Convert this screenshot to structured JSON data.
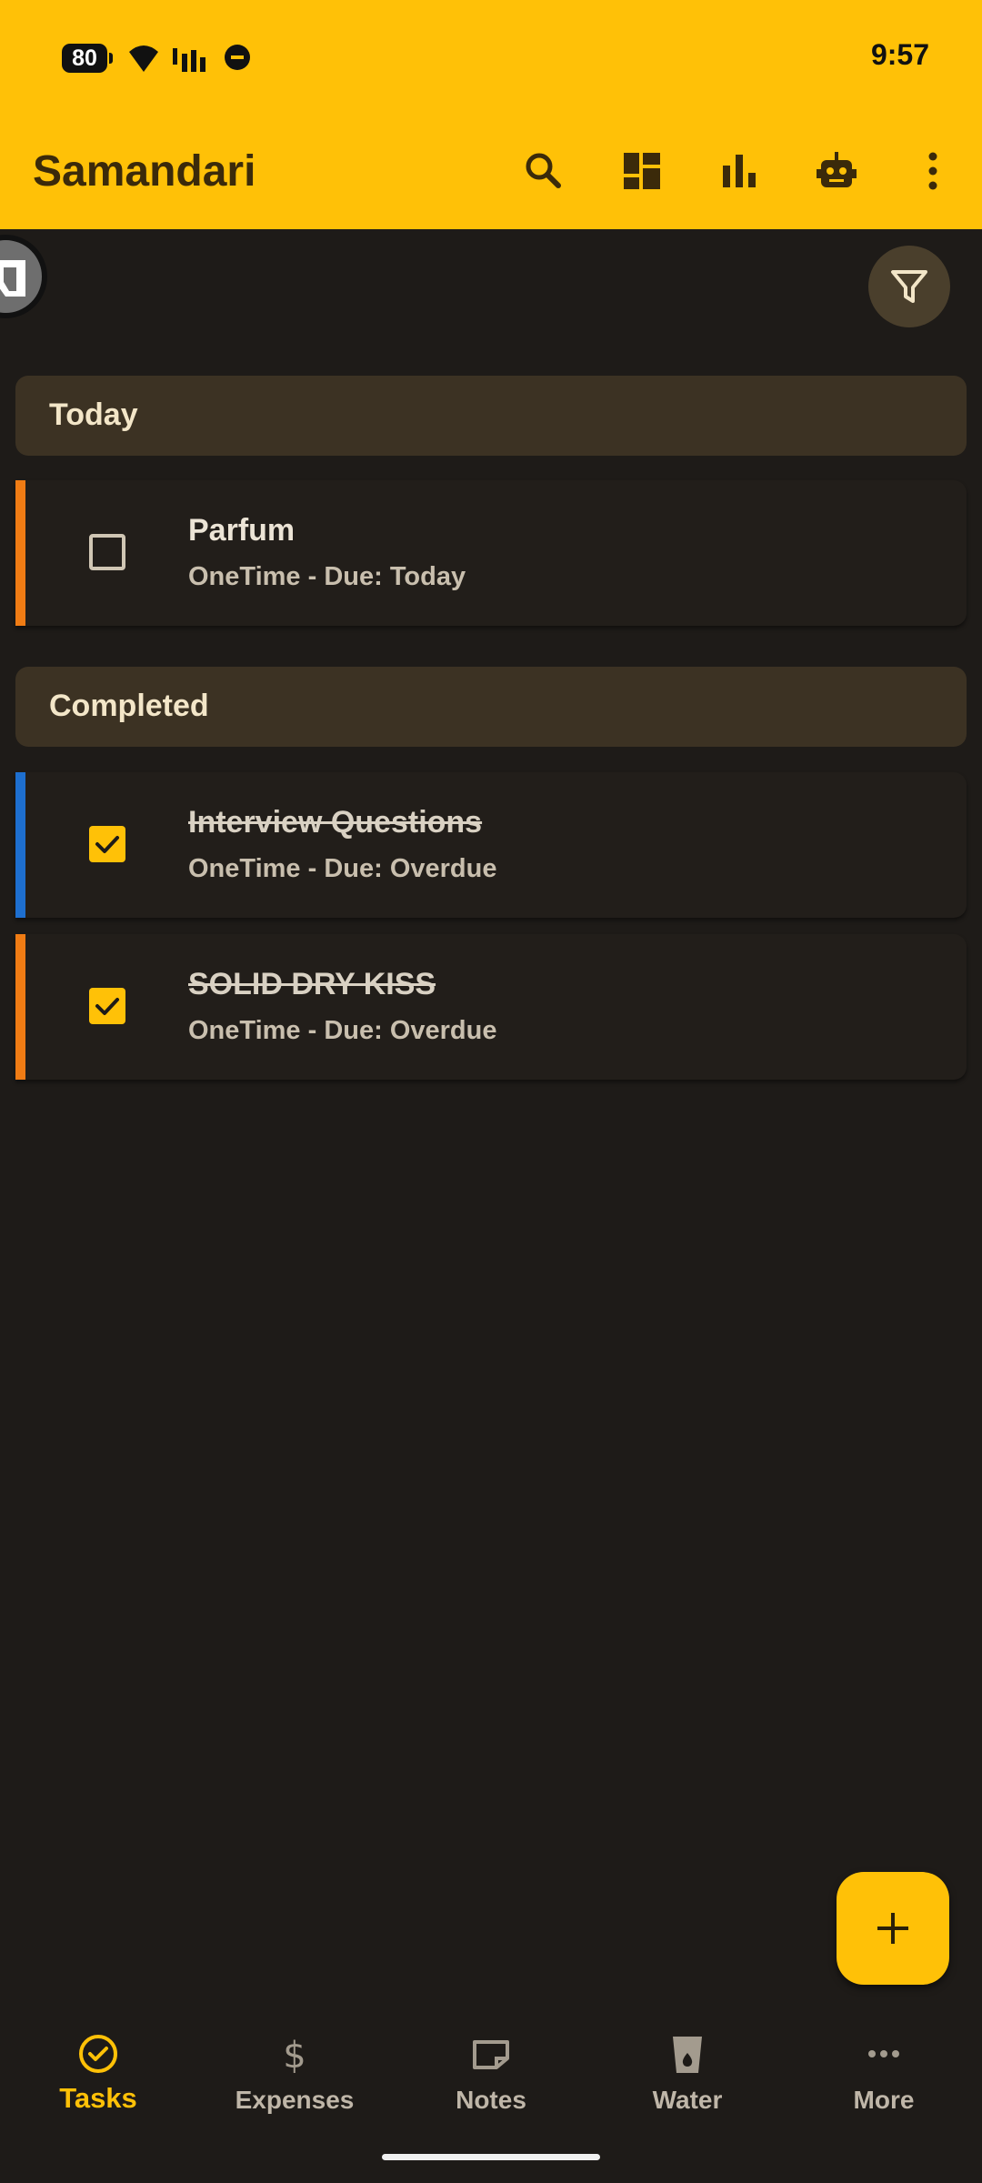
{
  "status_bar": {
    "battery": "80",
    "time": "9:57"
  },
  "app_bar": {
    "title": "Samandari",
    "actions": [
      "search-icon",
      "dashboard-icon",
      "bar-chart-icon",
      "robot-icon",
      "more-vert-icon"
    ]
  },
  "sections": [
    {
      "header": "Today",
      "tasks": [
        {
          "title": "Parfum",
          "subtitle": "OneTime - Due: Today",
          "checked": false,
          "color": "#f07c14"
        }
      ]
    },
    {
      "header": "Completed",
      "tasks": [
        {
          "title": "Interview Questions",
          "subtitle": "OneTime - Due: Overdue",
          "checked": true,
          "color": "#1e6fcf"
        },
        {
          "title": "SOLID DRY KISS",
          "subtitle": "OneTime - Due: Overdue",
          "checked": true,
          "color": "#f07c14"
        }
      ]
    }
  ],
  "bottom_nav": [
    {
      "label": "Tasks",
      "icon": "check-circle-icon",
      "active": true
    },
    {
      "label": "Expenses",
      "icon": "dollar-icon",
      "active": false
    },
    {
      "label": "Notes",
      "icon": "note-icon",
      "active": false
    },
    {
      "label": "Water",
      "icon": "water-glass-icon",
      "active": false
    },
    {
      "label": "More",
      "icon": "more-horiz-icon",
      "active": false
    }
  ],
  "colors": {
    "accent": "#ffc107",
    "background": "#1e1b18",
    "section_bg": "#3c3223"
  }
}
